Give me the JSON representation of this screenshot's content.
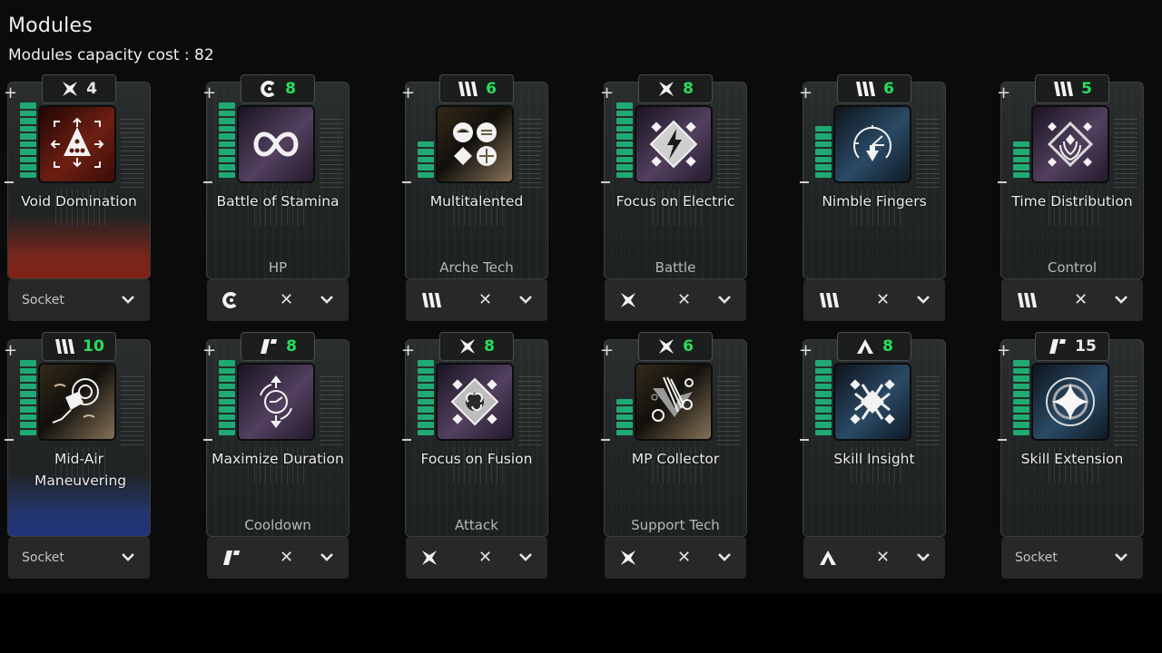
{
  "header": {
    "title": "Modules",
    "capacity_label": "Modules capacity cost : 82"
  },
  "colors": {
    "bar_green": "#1faa74",
    "cost_green": "#27e05a",
    "red_glow": "#b02818",
    "blue_glow": "#2a40a8"
  },
  "modules": [
    {
      "name": "Void Domination",
      "type_icon": "cross-star-icon",
      "cost": "4",
      "cost_color": "white",
      "level": 10,
      "category": "",
      "slot": "Socket",
      "icon": "void-domination-icon",
      "art": "red",
      "glow": "red"
    },
    {
      "name": "Battle of Stamina",
      "type_icon": "crescent-c-icon",
      "cost": "8",
      "cost_color": "green",
      "level": 10,
      "category": "HP",
      "slot": "equipped",
      "icon": "stamina-loop-icon",
      "art": "purple",
      "glow": ""
    },
    {
      "name": "Multitalented",
      "type_icon": "triple-slash-icon",
      "cost": "6",
      "cost_color": "green",
      "level": 5,
      "category": "Arche Tech",
      "slot": "equipped",
      "icon": "multitalented-icon",
      "art": "gold",
      "glow": ""
    },
    {
      "name": "Focus on Electric",
      "type_icon": "cross-star-icon",
      "cost": "8",
      "cost_color": "green",
      "level": 10,
      "category": "Battle",
      "slot": "equipped",
      "icon": "electric-focus-icon",
      "art": "purple",
      "glow": ""
    },
    {
      "name": "Nimble Fingers",
      "type_icon": "triple-slash-icon",
      "cost": "6",
      "cost_color": "green",
      "level": 7,
      "category": "",
      "slot": "equipped",
      "icon": "gauge-icon",
      "art": "blue",
      "glow": ""
    },
    {
      "name": "Time Distribution",
      "type_icon": "triple-slash-icon",
      "cost": "5",
      "cost_color": "green",
      "level": 5,
      "category": "Control",
      "slot": "equipped",
      "icon": "time-distribution-icon",
      "art": "purple",
      "glow": ""
    },
    {
      "name": "Mid-Air Maneuvering",
      "type_icon": "triple-slash-icon",
      "cost": "10",
      "cost_color": "green",
      "level": 10,
      "category": "",
      "slot": "Socket",
      "icon": "grapple-icon",
      "art": "gold",
      "glow": "blue"
    },
    {
      "name": "Maximize Duration",
      "type_icon": "slash-corner-icon",
      "cost": "8",
      "cost_color": "green",
      "level": 10,
      "category": "Cooldown",
      "slot": "equipped",
      "icon": "duration-clock-icon",
      "art": "purple",
      "glow": ""
    },
    {
      "name": "Focus on Fusion",
      "type_icon": "cross-star-icon",
      "cost": "8",
      "cost_color": "green",
      "level": 10,
      "category": "Attack",
      "slot": "equipped",
      "icon": "fusion-focus-icon",
      "art": "purple",
      "glow": ""
    },
    {
      "name": "MP Collector",
      "type_icon": "cross-star-icon",
      "cost": "6",
      "cost_color": "green",
      "level": 5,
      "category": "Support Tech",
      "slot": "equipped",
      "icon": "mp-collector-icon",
      "art": "gold",
      "glow": ""
    },
    {
      "name": "Skill Insight",
      "type_icon": "chevron-up-icon",
      "cost": "8",
      "cost_color": "green",
      "level": 10,
      "category": "",
      "slot": "equipped",
      "icon": "skill-insight-icon",
      "art": "blue",
      "glow": ""
    },
    {
      "name": "Skill Extension",
      "type_icon": "slash-corner-icon",
      "cost": "15",
      "cost_color": "white",
      "level": 10,
      "category": "",
      "slot": "Socket",
      "icon": "star-circle-icon",
      "art": "blue",
      "glow": ""
    }
  ],
  "max_level": 10
}
